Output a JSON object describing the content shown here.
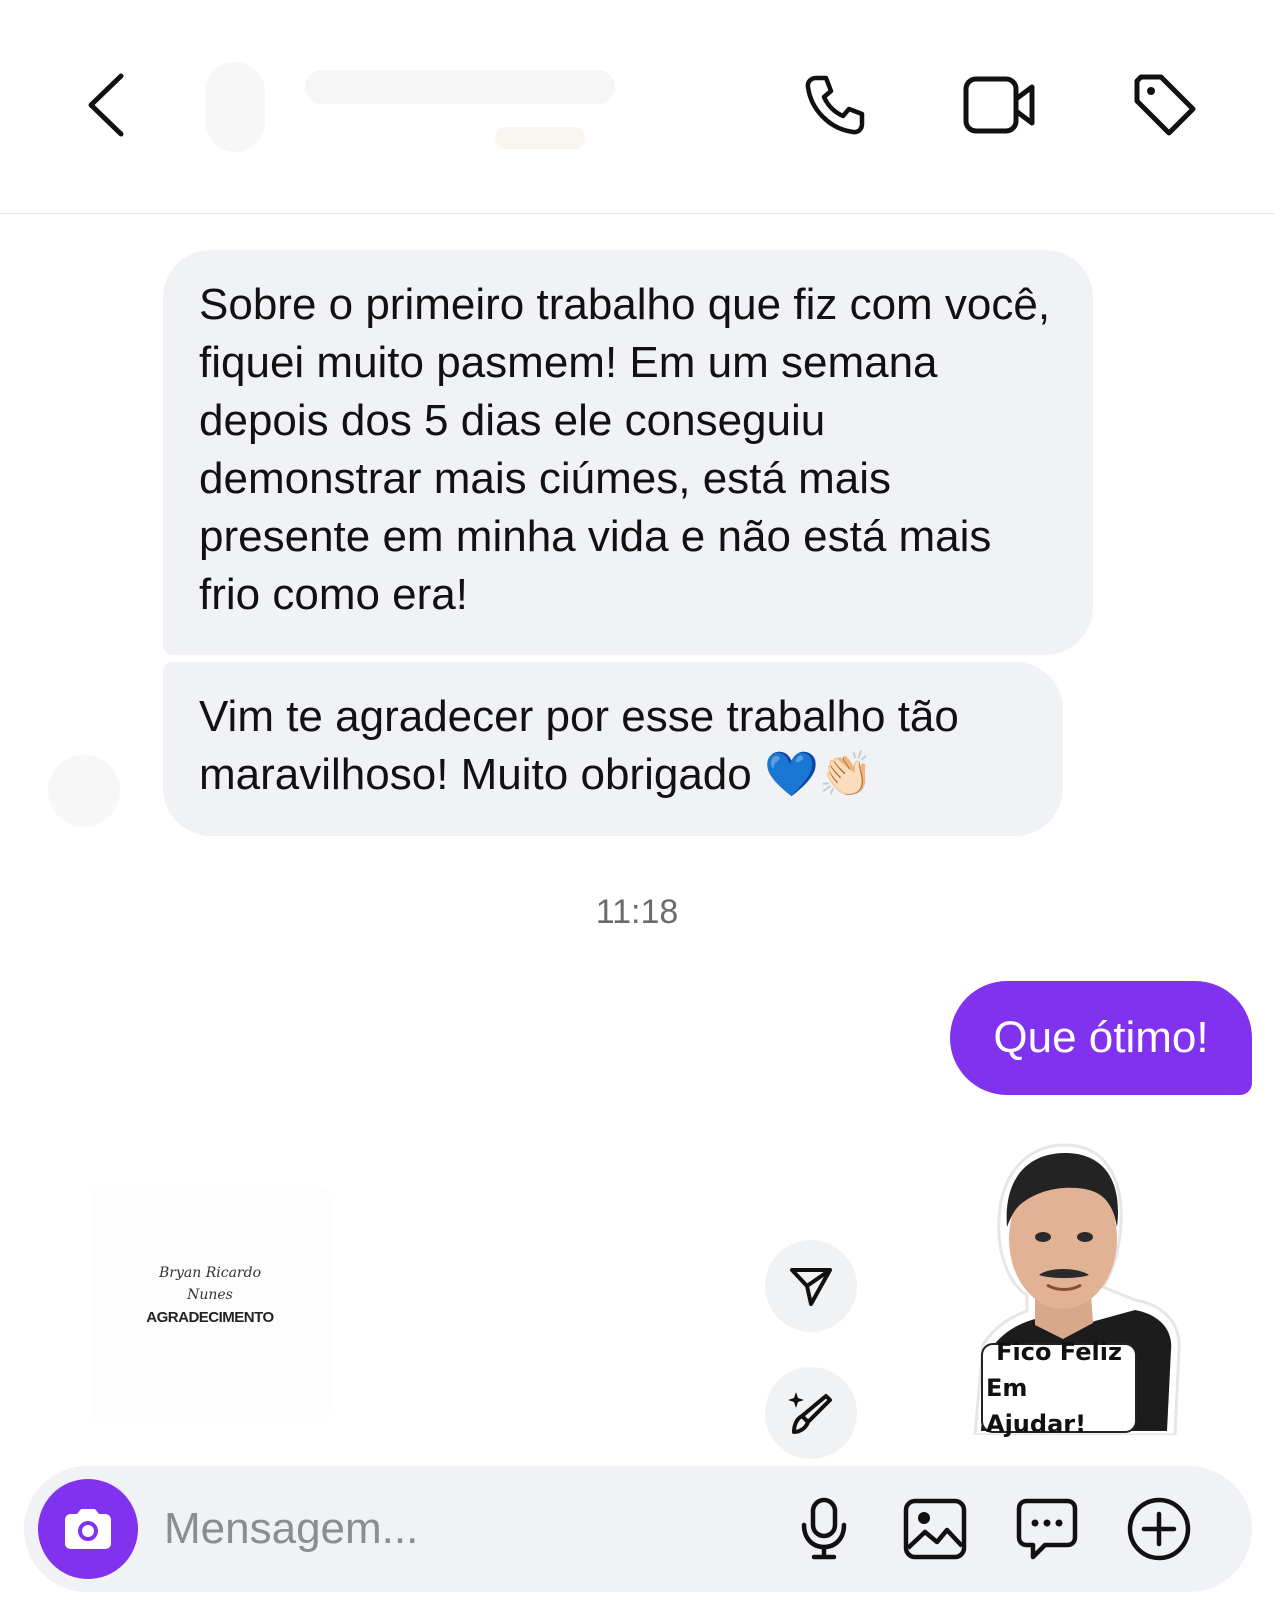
{
  "header": {
    "back_icon": "chevron-left-icon",
    "call_icon": "phone-icon",
    "video_icon": "video-camera-icon",
    "tag_icon": "tag-icon"
  },
  "conversation": {
    "incoming": [
      {
        "text": "Sobre o primeiro trabalho que fiz com você, fiquei muito pasmem! Em um semana depois dos 5 dias ele conseguiu demonstrar mais ciúmes, está mais presente em minha vida e não está mais frio como era!"
      },
      {
        "text": "Vim te agradecer por esse trabalho tão maravilhoso! Muito obrigado",
        "emojis": "💙👏🏻"
      }
    ],
    "timestamp": "11:18",
    "outgoing": [
      {
        "text": "Que ótimo!"
      }
    ],
    "image_card": {
      "script_line1": "Bryan Ricardo",
      "script_line2": "Nunes",
      "title": "AGRADECIMENTO"
    },
    "sticker": {
      "line1": "Fico Feliz",
      "line2": "Em Ajudar!"
    }
  },
  "actions": {
    "share_icon": "send-icon",
    "edit_icon": "magic-brush-icon"
  },
  "composer": {
    "placeholder": "Mensagem...",
    "camera_icon": "camera-icon",
    "mic_icon": "microphone-icon",
    "gallery_icon": "image-icon",
    "chat_icon": "chat-bubble-icon",
    "plus_icon": "plus-circle-icon"
  },
  "colors": {
    "accent": "#8132ef",
    "incoming_bubble": "#f0f2f5",
    "timestamp": "#6b6b6b"
  }
}
